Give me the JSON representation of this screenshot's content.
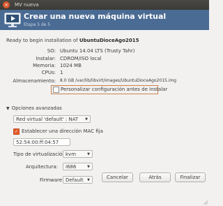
{
  "window": {
    "title": "MV nueva",
    "close_glyph": "×"
  },
  "header": {
    "title": "Crear una nueva máquina virtual",
    "step": "Etapa 5 de 5",
    "icon": "monitor-play-icon"
  },
  "summary": {
    "ready_prefix": "Ready to begin installation of ",
    "vm_name": "UbuntuDioceAgo2015",
    "rows": [
      {
        "label": "SO:",
        "value": "Ubuntu 14.04 LTS (Trusty Tahr)"
      },
      {
        "label": "Instalar:",
        "value": "CDROM/ISO local"
      },
      {
        "label": "Memoria:",
        "value": "1024 MB"
      },
      {
        "label": "CPUs:",
        "value": "1"
      },
      {
        "label": "Almacenamiento:",
        "value": "8.0 GB /var/lib/libvirt/images/UbuntuDioceAgo2015.img"
      }
    ],
    "customize_label": "Personalizar configuración antes de instalar",
    "customize_checked": false
  },
  "advanced": {
    "label": "Opciones avanzadas",
    "network": "Red virtual 'default' : NAT",
    "mac_label": "Establecer una dirección MAC fija",
    "mac_checked": true,
    "mac_value": "52:54:00:ff:04:57",
    "virt_type_label": "Tipo de virtualización:",
    "virt_type": "kvm",
    "arch_label": "Arquitectura:",
    "arch": "i686",
    "firmware_label": "Firmware:",
    "firmware": "Default"
  },
  "buttons": {
    "cancel": "Cancelar",
    "back": "Atrás",
    "finish": "Finalizar"
  },
  "colors": {
    "header_bg": "#4a6b93",
    "accent": "#e25b2a"
  }
}
